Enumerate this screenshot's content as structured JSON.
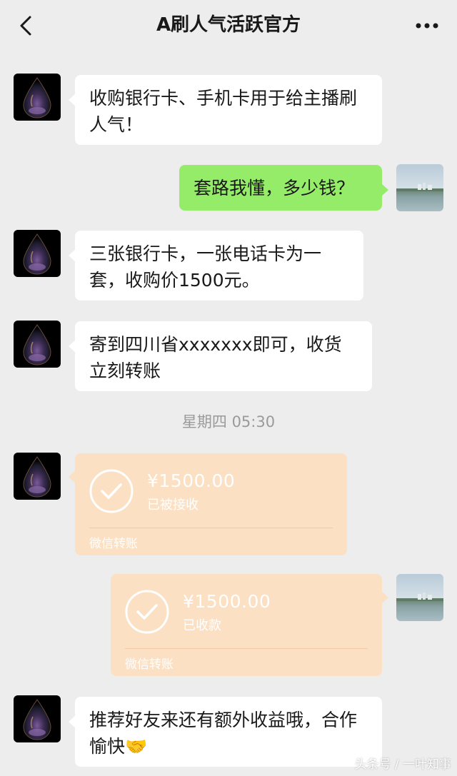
{
  "header": {
    "title": "A刷人气活跃官方",
    "back_icon": "chevron-left-icon",
    "more_icon": "more-dots-icon"
  },
  "messages": [
    {
      "side": "left",
      "type": "text",
      "text": "收购银行卡、手机卡用于给主播刷人气！"
    },
    {
      "side": "right",
      "type": "text",
      "text": "套路我懂，多少钱？"
    },
    {
      "side": "left",
      "type": "text",
      "text": "三张银行卡，一张电话卡为一套，收购价1500元。"
    },
    {
      "side": "left",
      "type": "text",
      "text": "寄到四川省xxxxxxx即可，收货立刻转账"
    },
    {
      "side": "left",
      "type": "transfer",
      "amount": "¥1500.00",
      "status": "已被接收",
      "footer": "微信转账"
    },
    {
      "side": "right",
      "type": "transfer",
      "amount": "¥1500.00",
      "status": "已收款",
      "footer": "微信转账"
    },
    {
      "side": "left",
      "type": "text",
      "text": "推荐好友来还有额外收益哦，合作愉快🤝"
    }
  ],
  "timestamp": "星期四 05:30",
  "watermark": "头条号 / 一叶知事",
  "colors": {
    "background": "#ededed",
    "bubble_white": "#ffffff",
    "bubble_green": "#95ec69",
    "transfer_bg": "#fbe0c3"
  }
}
